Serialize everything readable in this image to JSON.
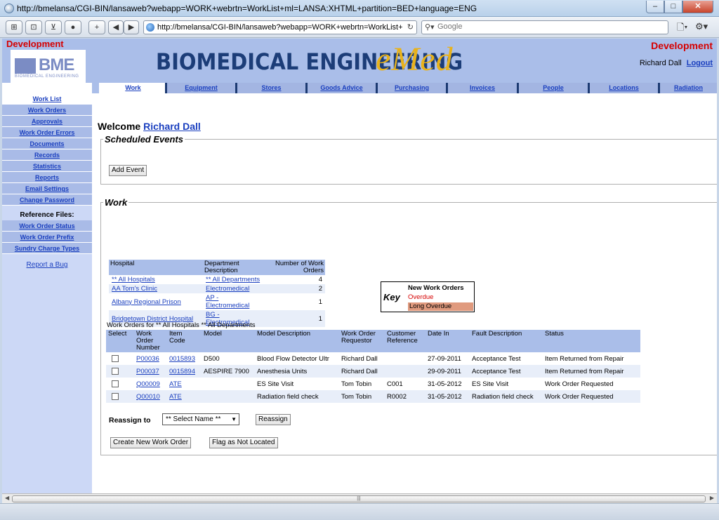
{
  "window": {
    "title": "http://bmelansa/CGI-BIN/lansaweb?webapp=WORK+webrtn=WorkList+ml=LANSA:XHTML+partition=BED+language=ENG",
    "url": "http://bmelansa/CGI-BIN/lansaweb?webapp=WORK+webrtn=WorkList+ml=LANSA",
    "search_placeholder": "Google"
  },
  "header": {
    "env_left": "Development",
    "env_right": "Development",
    "logo_text": "BME",
    "logo_sub": "BIOMEDICAL ENGINEERING",
    "banner": "BIOMEDICAL ENGINEERING",
    "app_name": "eMed",
    "user_name": "Richard Dall",
    "logout": "Logout"
  },
  "tabs": [
    "Work",
    "Equipment",
    "Stores",
    "Goods Advice",
    "Purchasing",
    "Invoices",
    "People",
    "Locations",
    "Radiation"
  ],
  "sidebar": {
    "items": [
      "Work List",
      "Work Orders",
      "Approvals",
      "Work Order Errors",
      "Documents",
      "Records",
      "Statistics",
      "Reports",
      "Email Settings",
      "Change Password"
    ],
    "ref_heading": "Reference Files:",
    "ref_items": [
      "Work Order Status",
      "Work Order Prefix",
      "Sundry Charge Types"
    ],
    "report_bug": "Report a Bug"
  },
  "main": {
    "welcome": "Welcome",
    "welcome_user": "Richard Dall",
    "scheduled_legend": "Scheduled Events",
    "add_event": "Add Event",
    "work_legend": "Work",
    "summary_headers": [
      "Hospital",
      "Department Description",
      "Number of Work Orders"
    ],
    "summary_rows": [
      [
        "** All Hospitals",
        "** All Departments",
        "4"
      ],
      [
        "AA Tom's Clinic",
        "Electromedical",
        "2"
      ],
      [
        "Albany Regional Prison",
        "AP - Electromedical",
        "1"
      ],
      [
        "Bridgetown District Hospital",
        "BG - Electromedical",
        "1"
      ]
    ],
    "key": {
      "label": "Key",
      "new": "New Work Orders",
      "overdue": "Overdue",
      "long_overdue": "Long Overdue"
    },
    "wo_title": "Work Orders for  ** All Hospitals ** All Departments",
    "wo_headers": [
      "Select",
      "Work Order Number",
      "Item Code",
      "Model",
      "Model Description",
      "Work Order Requestor",
      "Customer Reference",
      "Date In",
      "Fault Description",
      "Status"
    ],
    "wo_rows": [
      [
        "P00036",
        "0015893",
        "D500",
        "Blood Flow Detector Ultr",
        "Richard Dall",
        "",
        "27-09-2011",
        "Acceptance Test",
        "Item Returned from Repair"
      ],
      [
        "P00037",
        "0015894",
        "AESPIRE 7900",
        "Anesthesia Units",
        "Richard Dall",
        "",
        "29-09-2011",
        "Acceptance Test",
        "Item Returned from Repair"
      ],
      [
        "Q00009",
        "ATE",
        "",
        "ES Site Visit",
        "Tom Tobin",
        "C001",
        "31-05-2012",
        "ES Site Visit",
        "Work Order Requested"
      ],
      [
        "Q00010",
        "ATE",
        "",
        "Radiation field check",
        "Tom Tobin",
        "R0002",
        "31-05-2012",
        "Radiation field check",
        "Work Order Requested"
      ]
    ],
    "reassign_label": "Reassign to",
    "reassign_select": "** Select Name **",
    "reassign_button": "Reassign",
    "create_button": "Create New Work Order",
    "flag_button": "Flag as Not Located"
  },
  "colors": {
    "header_bg": "#aabee9",
    "link": "#1a3fbf",
    "dev_red": "#d60000",
    "brand_gold": "#e8b21c"
  }
}
